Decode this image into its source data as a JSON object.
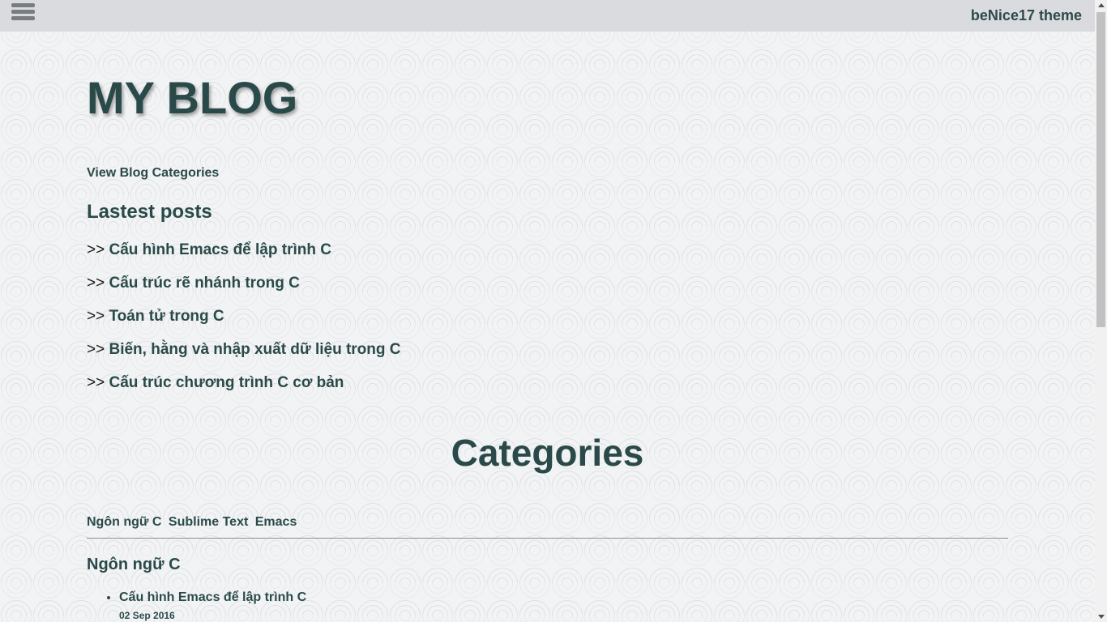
{
  "header": {
    "menu_icon": "hamburger-menu-icon",
    "theme_title": "beNice17 theme"
  },
  "blog": {
    "title": "MY BLOG",
    "view_categories_link": "View Blog Categories",
    "latest_heading": "Lastest posts",
    "post_prefix": ">>",
    "latest_posts": [
      "Cấu hình Emacs để lập trình C",
      "Cấu trúc rẽ nhánh trong C",
      "Toán tử trong C",
      "Biến, hằng và nhập xuất dữ liệu trong C",
      "Cấu trúc chương trình C cơ bản"
    ]
  },
  "categories": {
    "heading": "Categories",
    "tags": [
      "Ngôn ngữ C",
      "Sublime Text",
      "Emacs"
    ],
    "sections": [
      {
        "title": "Ngôn ngữ C",
        "posts": [
          {
            "title": "Cấu hình Emacs để lập trình C",
            "date": "02 Sep 2016"
          }
        ]
      }
    ]
  },
  "colors": {
    "text": "#2a4a4a",
    "topbar": "#d7d9dc",
    "background": "#f2f3f4"
  }
}
